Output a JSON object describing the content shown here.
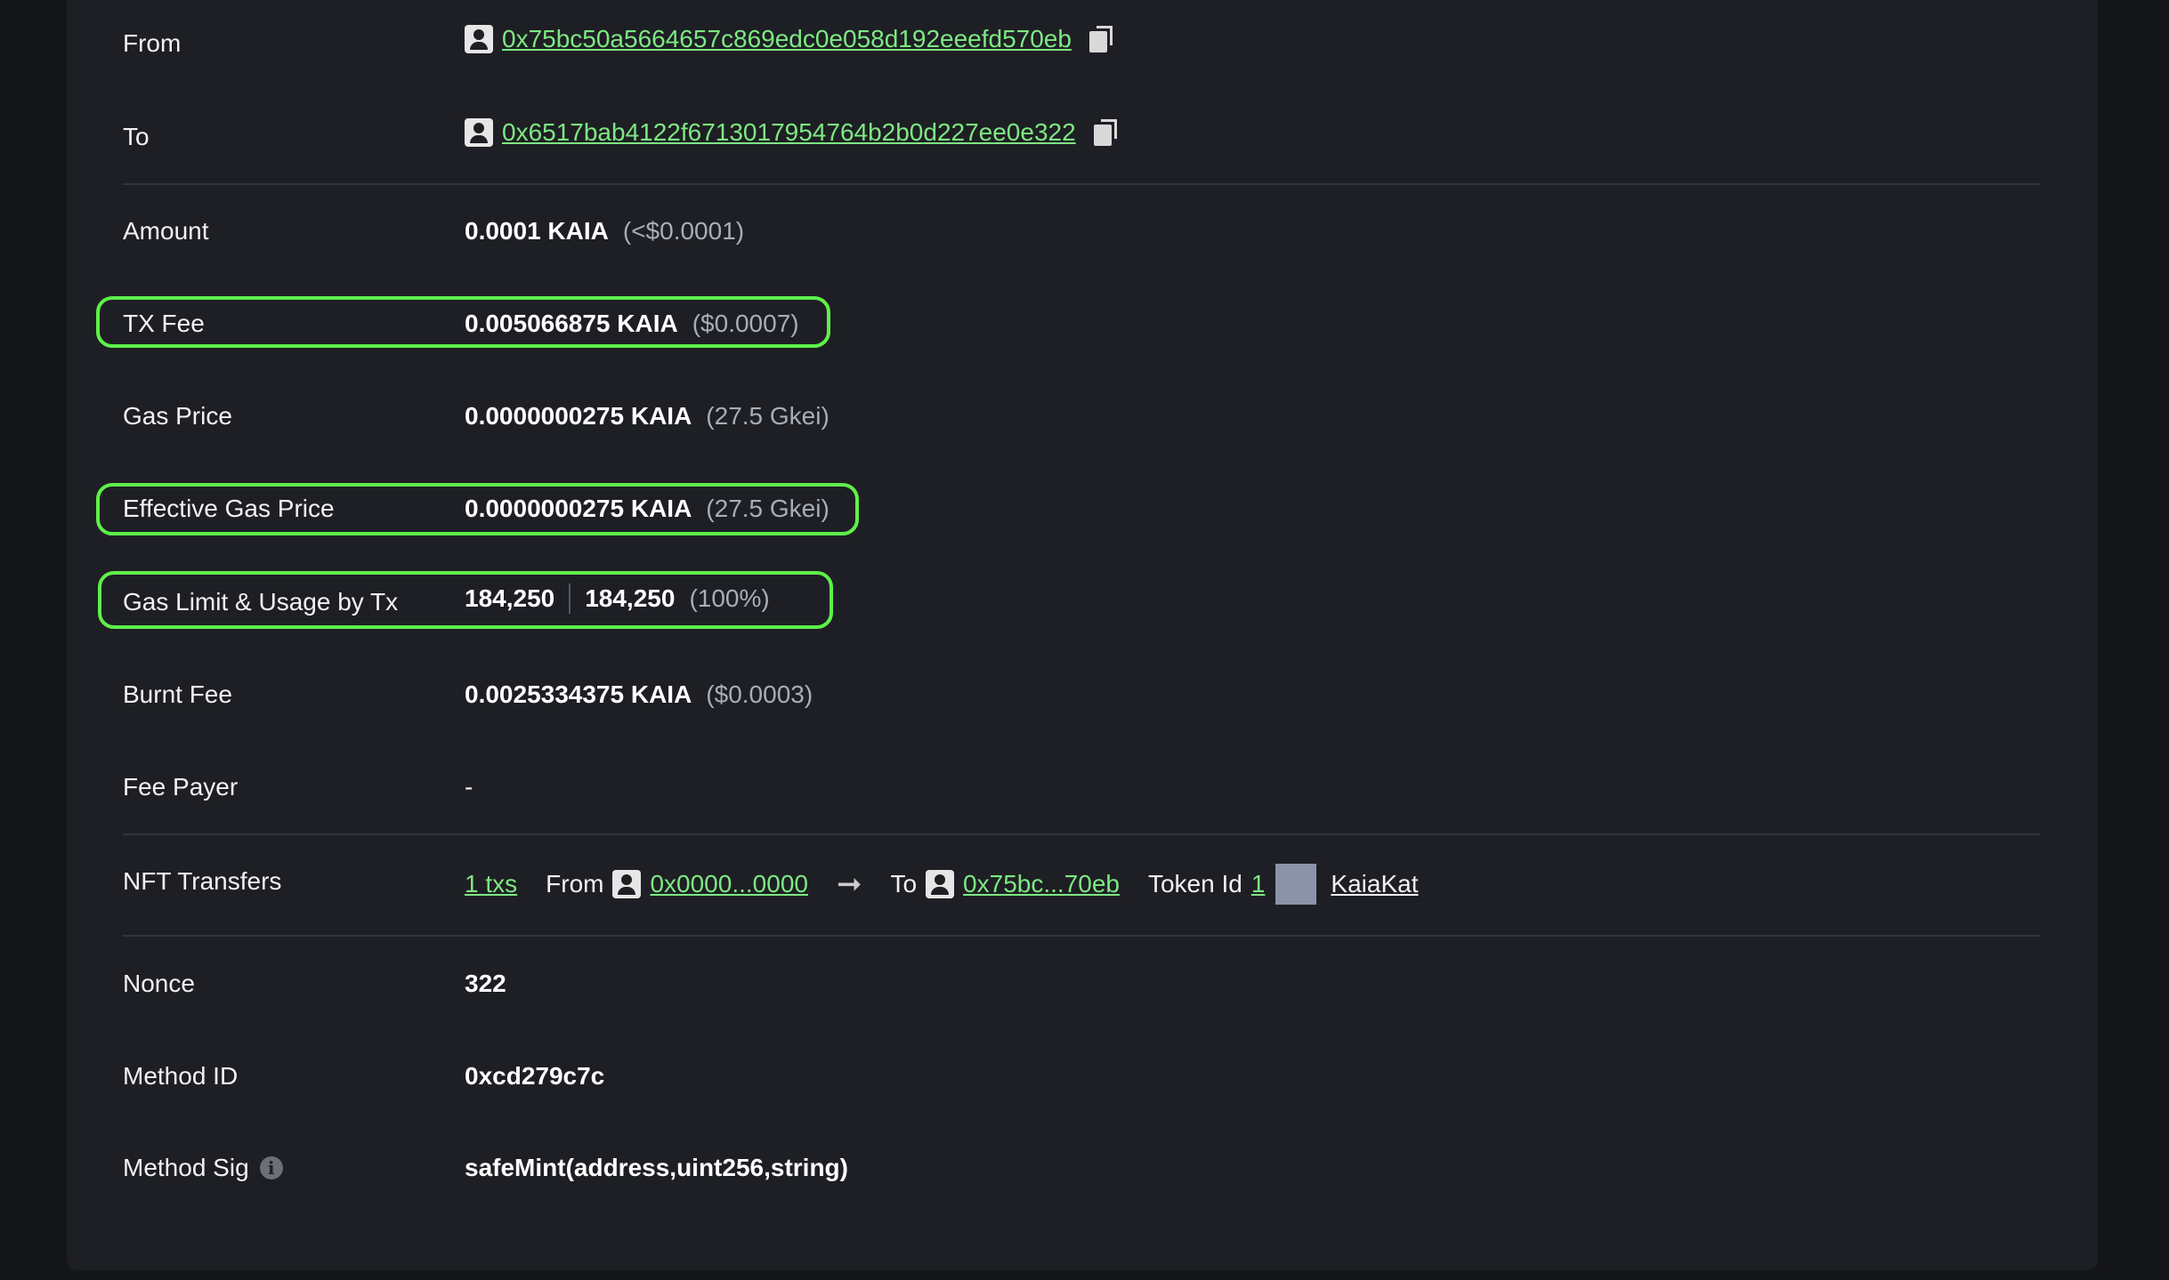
{
  "rows": {
    "from": {
      "label": "From",
      "address": "0x75bc50a5664657c869edc0e058d192eeefd570eb"
    },
    "to": {
      "label": "To",
      "address": "0x6517bab4122f6713017954764b2b0d227ee0e322"
    },
    "amount": {
      "label": "Amount",
      "value": "0.0001 KAIA",
      "usd": "(<$0.0001)"
    },
    "tx_fee": {
      "label": "TX Fee",
      "value": "0.005066875 KAIA",
      "usd": "($0.0007)"
    },
    "gas_price": {
      "label": "Gas Price",
      "value": "0.0000000275 KAIA",
      "sub": "(27.5 Gkei)"
    },
    "effective_gas_price": {
      "label": "Effective Gas Price",
      "value": "0.0000000275 KAIA",
      "sub": "(27.5 Gkei)"
    },
    "gas_limit": {
      "label": "Gas Limit & Usage by Tx",
      "limit": "184,250",
      "usage": "184,250",
      "percent": "(100%)"
    },
    "burnt_fee": {
      "label": "Burnt Fee",
      "value": "0.0025334375 KAIA",
      "usd": "($0.0003)"
    },
    "fee_payer": {
      "label": "Fee Payer",
      "value": "-"
    },
    "nft_transfers": {
      "label": "NFT Transfers",
      "txs": "1 txs",
      "from_label": "From",
      "from_address": "0x0000...0000",
      "to_label": "To",
      "to_address": "0x75bc...70eb",
      "token_id_label": "Token Id",
      "token_id": "1",
      "token_name": "KaiaKat"
    },
    "nonce": {
      "label": "Nonce",
      "value": "322"
    },
    "method_id": {
      "label": "Method ID",
      "value": "0xcd279c7c"
    },
    "method_sig": {
      "label": "Method Sig",
      "value": "safeMint(address,uint256,string)"
    }
  },
  "colors": {
    "link": "#7ee883",
    "highlight": "#5ef04a",
    "panel": "#1e1f24",
    "background": "#141519"
  },
  "icons": {
    "address": "person-icon",
    "copy": "copy-icon",
    "arrow": "arrow-right-icon",
    "info": "info-icon"
  }
}
